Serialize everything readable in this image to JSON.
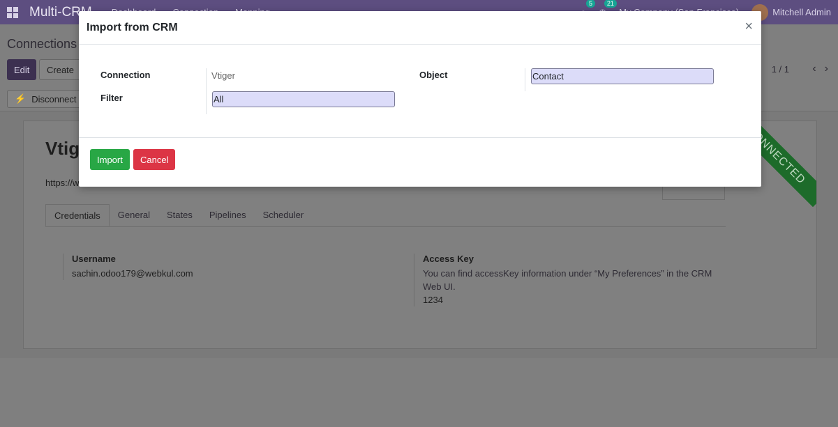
{
  "navbar": {
    "brand": "Multi-CRM",
    "menu": [
      "Dashboard",
      "Connection",
      "Mapping"
    ],
    "chat_count": "5",
    "activity_count": "21",
    "company": "My Company (San Francisco)",
    "user": "Mitchell Admin"
  },
  "control_panel": {
    "breadcrumb": "Connections",
    "edit_label": "Edit",
    "create_label": "Create",
    "pager": "1 / 1",
    "disconnect_label": "Disconnect"
  },
  "record": {
    "title": "Vtiger",
    "url": "https://w",
    "ribbon": "CONNECTED",
    "tabs": [
      "Credentials",
      "General",
      "States",
      "Pipelines",
      "Scheduler"
    ],
    "username_label": "Username",
    "username_value": "sachin.odoo179@webkul.com",
    "access_key_label": "Access Key",
    "access_key_help": "You can find accessKey information under “My Preferences” in the CRM Web UI.",
    "access_key_value": "1234"
  },
  "modal": {
    "title": "Import from CRM",
    "close_glyph": "×",
    "connection_label": "Connection",
    "connection_value": "Vtiger",
    "object_label": "Object",
    "object_value": "Contact",
    "filter_label": "Filter",
    "filter_value": "All",
    "import_label": "Import",
    "cancel_label": "Cancel"
  },
  "colors": {
    "navbar": "#5d4e80",
    "import_button": "#28a745",
    "cancel_button": "#dc3545",
    "input_bg": "#dcdcf9",
    "ribbon": "#1d6b2a"
  }
}
